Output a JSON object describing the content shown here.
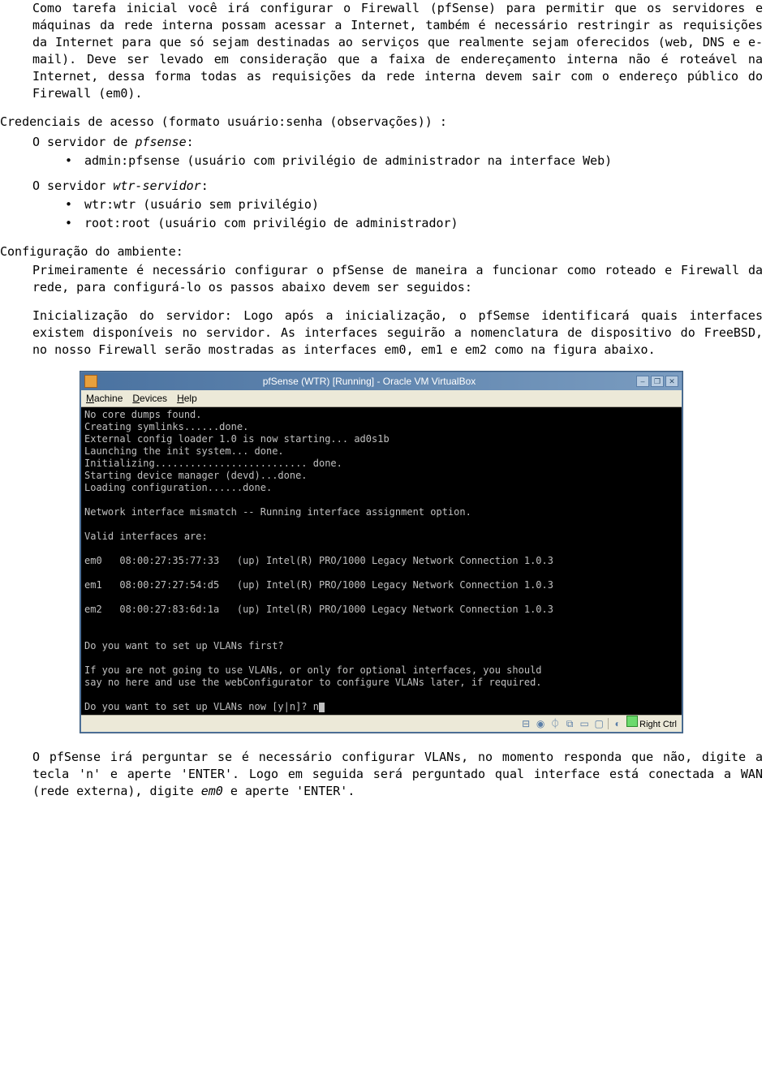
{
  "p1": "Como tarefa inicial você irá configurar o Firewall (pfSense) para permitir que os servidores e máquinas da rede interna possam acessar a Internet, também é necessário restringir as requisições da Internet para que só sejam destinadas ao serviços que realmente sejam oferecidos (web, DNS e e-mail). Deve ser levado em consideração que a faixa de endereçamento interna não é roteável na Internet, dessa forma todas as requisições da rede interna devem sair com o endereço público do Firewall (em0).",
  "creds_heading": "Credenciais de acesso (formato usuário:senha (observações)) :",
  "server_pfsense_prefix": "O servidor de ",
  "server_pfsense_name": "pfsense",
  "colon": ":",
  "cred_pfsense": "admin:pfsense (usuário com privilégio de administrador na interface Web)",
  "server_wtr_prefix": "O servidor ",
  "server_wtr_name": "wtr-servidor",
  "cred_wtr1": "wtr:wtr (usuário sem privilégio)",
  "cred_wtr2": "root:root (usuário com privilégio de administrador)",
  "config_heading": "Configuração do ambiente:",
  "config_p1": "Primeiramente é necessário configurar o pfSense de maneira a funcionar como roteado e Firewall da rede, para configurá-lo os passos abaixo devem ser seguidos:",
  "config_p2": "Inicialização do servidor: Logo após a inicialização, o pfSemse identificará quais interfaces existem disponíveis no servidor. As interfaces seguirão a nomenclatura de dispositivo do FreeBSD, no nosso Firewall serão mostradas as interfaces em0, em1 e em2 como na figura abaixo.",
  "vm": {
    "title": "pfSense (WTR) [Running] - Oracle VM VirtualBox",
    "menu": {
      "machine": "Machine",
      "devices": "Devices",
      "help": "Help"
    },
    "console": "No core dumps found.\nCreating symlinks......done.\nExternal config loader 1.0 is now starting... ad0s1b\nLaunching the init system... done.\nInitializing.......................... done.\nStarting device manager (devd)...done.\nLoading configuration......done.\n\nNetwork interface mismatch -- Running interface assignment option.\n\nValid interfaces are:\n\nem0   08:00:27:35:77:33   (up) Intel(R) PRO/1000 Legacy Network Connection 1.0.3\n\nem1   08:00:27:27:54:d5   (up) Intel(R) PRO/1000 Legacy Network Connection 1.0.3\n\nem2   08:00:27:83:6d:1a   (up) Intel(R) PRO/1000 Legacy Network Connection 1.0.3\n\n\nDo you want to set up VLANs first?\n\nIf you are not going to use VLANs, or only for optional interfaces, you should\nsay no here and use the webConfigurator to configure VLANs later, if required.\n\nDo you want to set up VLANs now [y|n]? n",
    "hostkey": "Right Ctrl"
  },
  "p_after_prefix": "O pfSense irá perguntar se é necessário configurar VLANs, no momento responda que não, digite a tecla 'n' e aperte 'ENTER'. Logo em seguida será perguntado qual interface está conectada a WAN (rede externa), digite ",
  "p_after_em0": "em0",
  "p_after_suffix": " e aperte 'ENTER'."
}
